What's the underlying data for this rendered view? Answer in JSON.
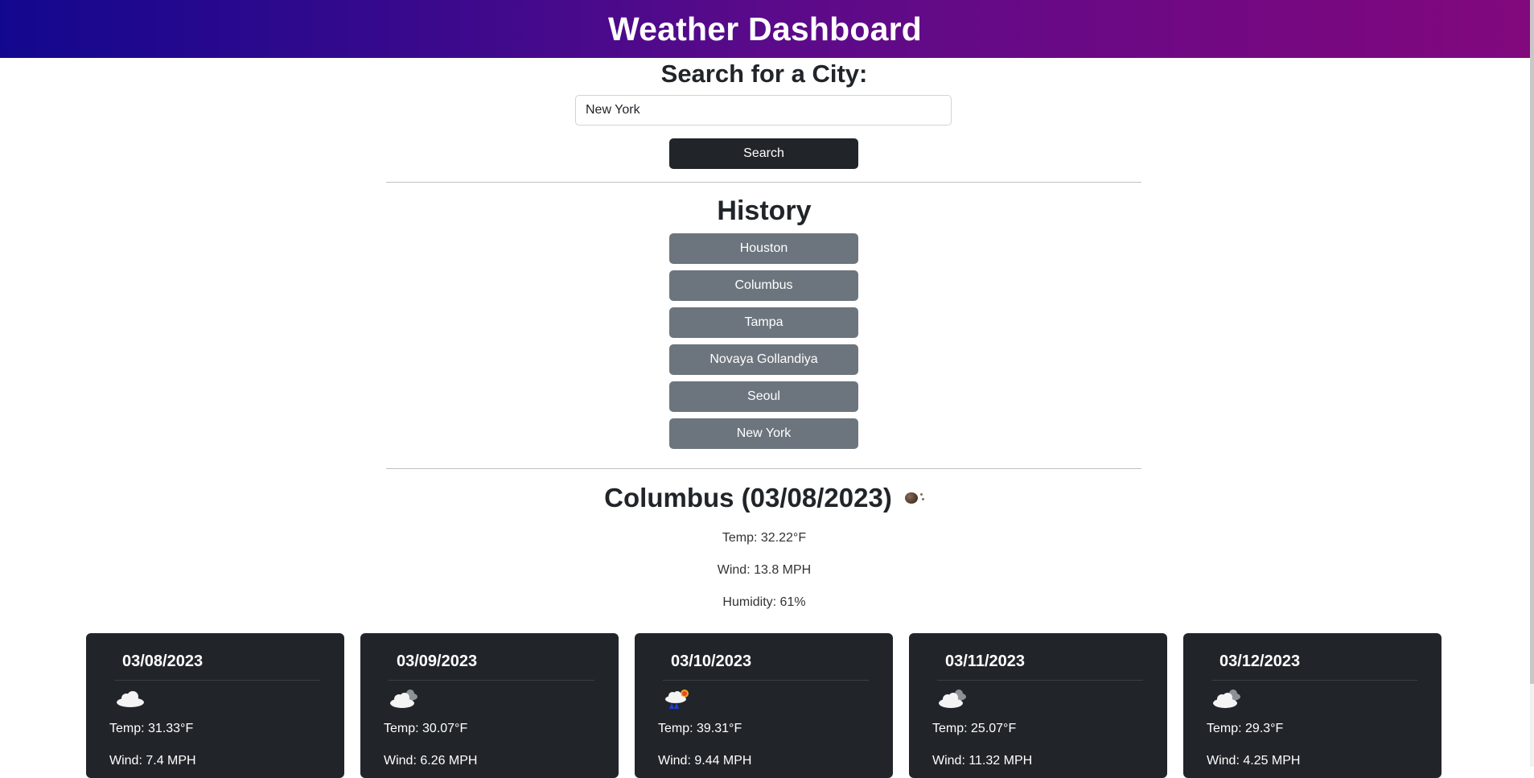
{
  "header": {
    "title": "Weather Dashboard"
  },
  "search": {
    "title": "Search for a City:",
    "input_value": "New York",
    "button_label": "Search"
  },
  "history": {
    "title": "History",
    "items": [
      "Houston",
      "Columbus",
      "Tampa",
      "Novaya Gollandiya",
      "Seoul",
      "New York"
    ]
  },
  "current": {
    "title": "Columbus (03/08/2023)",
    "icon": "drizzle-ball-icon",
    "temp": "Temp: 32.22°F",
    "wind": "Wind: 13.8 MPH",
    "humidity": "Humidity: 61%"
  },
  "forecast": [
    {
      "date": "03/08/2023",
      "icon": "cloud-icon",
      "temp": "Temp: 31.33°F",
      "wind": "Wind: 7.4 MPH"
    },
    {
      "date": "03/09/2023",
      "icon": "overcast-clouds-icon",
      "temp": "Temp: 30.07°F",
      "wind": "Wind: 6.26 MPH"
    },
    {
      "date": "03/10/2023",
      "icon": "rain-sun-cloud-icon",
      "temp": "Temp: 39.31°F",
      "wind": "Wind: 9.44 MPH"
    },
    {
      "date": "03/11/2023",
      "icon": "overcast-clouds-icon",
      "temp": "Temp: 25.07°F",
      "wind": "Wind: 11.32 MPH"
    },
    {
      "date": "03/12/2023",
      "icon": "overcast-clouds-icon",
      "temp": "Temp: 29.3°F",
      "wind": "Wind: 4.25 MPH"
    }
  ],
  "colors": {
    "header_gradient_start": "#12088f",
    "header_gradient_end": "#82087d",
    "search_button": "#212529",
    "history_button": "#6c757d",
    "card_background": "#212529"
  }
}
